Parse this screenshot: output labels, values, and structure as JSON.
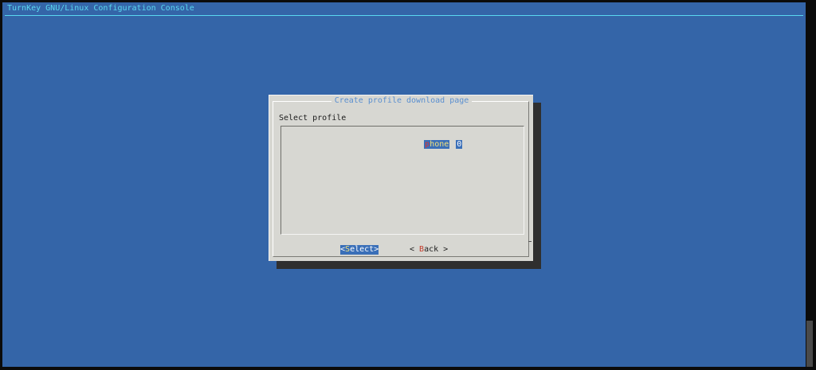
{
  "backtitle": "TurnKey GNU/Linux Configuration Console",
  "dialog": {
    "title": "Create profile download page",
    "prompt": "Select profile",
    "list_items": [
      {
        "tag": "phone",
        "description": "0",
        "selected": true
      }
    ],
    "buttons": {
      "select_label": "Select",
      "back_label": "Back"
    }
  },
  "colors": {
    "background": "#3465a8",
    "dialog": "#d7d7d2",
    "title": "#5a8fd0",
    "backtitle": "#5ad8f0",
    "highlight": "#3a6fb8"
  }
}
